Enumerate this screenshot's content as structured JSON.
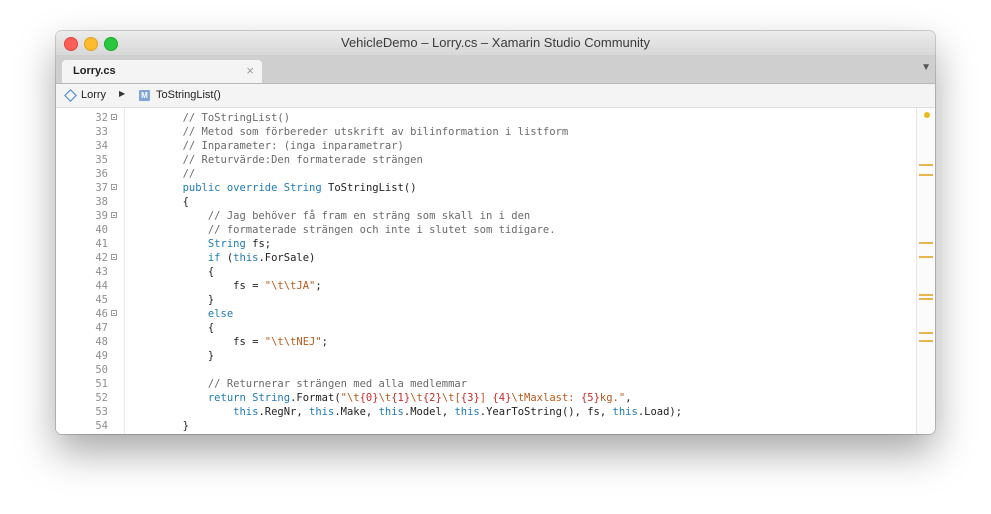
{
  "window": {
    "title": "VehicleDemo – Lorry.cs – Xamarin Studio Community"
  },
  "tabs": [
    {
      "label": "Lorry.cs",
      "close": "×"
    }
  ],
  "tab_dropdown": "▼",
  "breadcrumb": {
    "class_name": "Lorry",
    "separator": "▶",
    "method_icon_letter": "M",
    "method_name": "ToStringList()"
  },
  "editor": {
    "lines": [
      {
        "n": "32",
        "fold": true,
        "code": [
          {
            "t": "        "
          },
          {
            "t": "// ToStringList()",
            "c": "cm"
          }
        ]
      },
      {
        "n": "33",
        "fold": false,
        "code": [
          {
            "t": "        "
          },
          {
            "t": "// Metod som förbereder utskrift av bilinformation i listform",
            "c": "cm"
          }
        ]
      },
      {
        "n": "34",
        "fold": false,
        "code": [
          {
            "t": "        "
          },
          {
            "t": "// Inparameter: (inga inparametrar)",
            "c": "cm"
          }
        ]
      },
      {
        "n": "35",
        "fold": false,
        "code": [
          {
            "t": "        "
          },
          {
            "t": "// Returvärde:Den formaterade strängen",
            "c": "cm"
          }
        ]
      },
      {
        "n": "36",
        "fold": false,
        "code": [
          {
            "t": "        "
          },
          {
            "t": "//",
            "c": "cm"
          }
        ]
      },
      {
        "n": "37",
        "fold": true,
        "code": [
          {
            "t": "        "
          },
          {
            "t": "public",
            "c": "kw"
          },
          {
            "t": " "
          },
          {
            "t": "override",
            "c": "kw"
          },
          {
            "t": " "
          },
          {
            "t": "String",
            "c": "kw"
          },
          {
            "t": " ToStringList()"
          }
        ]
      },
      {
        "n": "38",
        "fold": false,
        "code": [
          {
            "t": "        {"
          }
        ]
      },
      {
        "n": "39",
        "fold": true,
        "code": [
          {
            "t": "            "
          },
          {
            "t": "// Jag behöver få fram en sträng som skall in i den",
            "c": "cm"
          }
        ]
      },
      {
        "n": "40",
        "fold": false,
        "code": [
          {
            "t": "            "
          },
          {
            "t": "// formaterade strängen och inte i slutet som tidigare.",
            "c": "cm"
          }
        ]
      },
      {
        "n": "41",
        "fold": false,
        "code": [
          {
            "t": "            "
          },
          {
            "t": "String",
            "c": "kw"
          },
          {
            "t": " fs;"
          }
        ]
      },
      {
        "n": "42",
        "fold": true,
        "code": [
          {
            "t": "            "
          },
          {
            "t": "if",
            "c": "kw"
          },
          {
            "t": " ("
          },
          {
            "t": "this",
            "c": "kw"
          },
          {
            "t": ".ForSale)"
          }
        ]
      },
      {
        "n": "43",
        "fold": false,
        "code": [
          {
            "t": "            {"
          }
        ]
      },
      {
        "n": "44",
        "fold": false,
        "code": [
          {
            "t": "                fs = "
          },
          {
            "t": "\"\\t\\tJA\"",
            "c": "str"
          },
          {
            "t": ";"
          }
        ]
      },
      {
        "n": "45",
        "fold": false,
        "code": [
          {
            "t": "            }"
          }
        ]
      },
      {
        "n": "46",
        "fold": true,
        "code": [
          {
            "t": "            "
          },
          {
            "t": "else",
            "c": "kw"
          }
        ]
      },
      {
        "n": "47",
        "fold": false,
        "code": [
          {
            "t": "            {"
          }
        ]
      },
      {
        "n": "48",
        "fold": false,
        "code": [
          {
            "t": "                fs = "
          },
          {
            "t": "\"\\t\\tNEJ\"",
            "c": "str"
          },
          {
            "t": ";"
          }
        ]
      },
      {
        "n": "49",
        "fold": false,
        "code": [
          {
            "t": "            }"
          }
        ]
      },
      {
        "n": "50",
        "fold": false,
        "code": [
          {
            "t": ""
          }
        ]
      },
      {
        "n": "51",
        "fold": false,
        "code": [
          {
            "t": "            "
          },
          {
            "t": "// Returnerar strängen med alla medlemmar",
            "c": "cm"
          }
        ]
      },
      {
        "n": "52",
        "fold": false,
        "code": [
          {
            "t": "            "
          },
          {
            "t": "return",
            "c": "kw"
          },
          {
            "t": " "
          },
          {
            "t": "String",
            "c": "kw"
          },
          {
            "t": ".Format("
          },
          {
            "t": "\"\\t",
            "c": "str"
          },
          {
            "t": "{0}",
            "c": "fmt"
          },
          {
            "t": "\\t",
            "c": "str"
          },
          {
            "t": "{1}",
            "c": "fmt"
          },
          {
            "t": "\\t",
            "c": "str"
          },
          {
            "t": "{2}",
            "c": "fmt"
          },
          {
            "t": "\\t[",
            "c": "str"
          },
          {
            "t": "{3}",
            "c": "fmt"
          },
          {
            "t": "] ",
            "c": "str"
          },
          {
            "t": "{4}",
            "c": "fmt"
          },
          {
            "t": "\\tMaxlast: ",
            "c": "str"
          },
          {
            "t": "{5}",
            "c": "fmt"
          },
          {
            "t": "kg.\"",
            "c": "str"
          },
          {
            "t": ","
          }
        ]
      },
      {
        "n": "53",
        "fold": false,
        "code": [
          {
            "t": "                "
          },
          {
            "t": "this",
            "c": "kw"
          },
          {
            "t": ".RegNr, "
          },
          {
            "t": "this",
            "c": "kw"
          },
          {
            "t": ".Make, "
          },
          {
            "t": "this",
            "c": "kw"
          },
          {
            "t": ".Model, "
          },
          {
            "t": "this",
            "c": "kw"
          },
          {
            "t": ".YearToString(), fs, "
          },
          {
            "t": "this",
            "c": "kw"
          },
          {
            "t": ".Load);"
          }
        ]
      },
      {
        "n": "54",
        "fold": false,
        "code": [
          {
            "t": "        }"
          }
        ]
      }
    ]
  },
  "colors": {
    "comment": "#6a6a6a",
    "keyword": "#1d7bb3",
    "string": "#b55a1a",
    "format_item": "#c42a2a",
    "overview_marker": "#eab44f",
    "overview_dot": "#e9b923"
  }
}
